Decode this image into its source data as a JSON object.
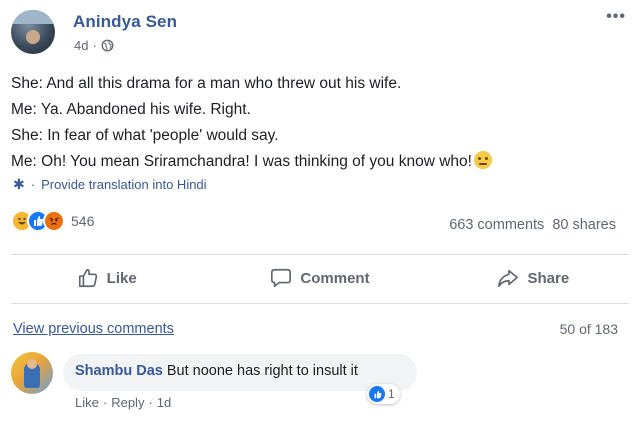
{
  "post": {
    "author": "Anindya Sen",
    "time": "4d",
    "time_sep": "·",
    "more_icon": "more-dots-icon",
    "privacy_icon": "globe-icon",
    "lines": [
      "She: And all this drama for a man who threw out his wife.",
      "Me: Ya. Abandoned his wife. Right.",
      "She: In fear of what 'people' would say.",
      "Me: Oh! You mean Sriramchandra! I was thinking of you know who!"
    ],
    "translate": "Provide translation into Hindi",
    "translate_sep": "·",
    "reaction_count": "546",
    "comments_count": "663 comments",
    "shares_count": "80 shares"
  },
  "actions": {
    "like": "Like",
    "comment": "Comment",
    "share": "Share"
  },
  "comments": {
    "view_previous": "View previous comments",
    "pager": "50 of 183",
    "items": [
      {
        "name": "Shambu Das",
        "text": "But noone has right to insult it",
        "reaction_count": "1",
        "like": "Like",
        "reply": "Reply",
        "time": "1d",
        "sep": "·"
      }
    ]
  },
  "colors": {
    "link": "#385898",
    "muted": "#606770",
    "like_blue": "#1877f2",
    "haha_yellow": "#f5b731",
    "angry_orange": "#e9710f"
  }
}
